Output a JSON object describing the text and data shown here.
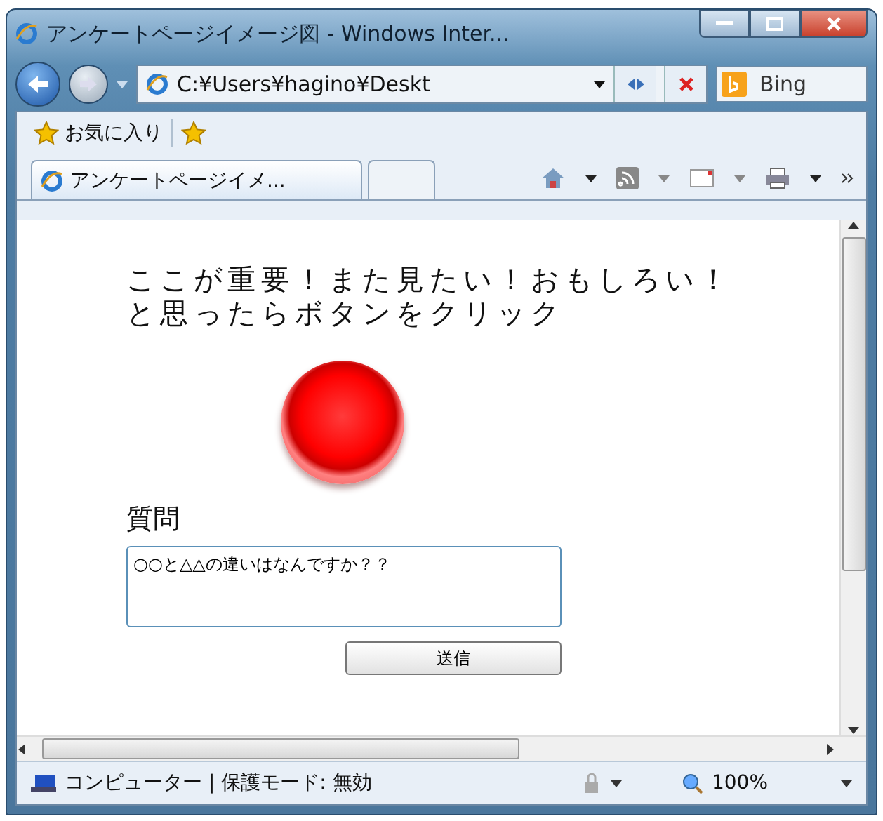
{
  "window": {
    "title": "アンケートページイメージ図 - Windows Inter..."
  },
  "address_bar": {
    "value": "C:¥Users¥hagino¥Deskt"
  },
  "search": {
    "placeholder": "Bing"
  },
  "favorites_bar": {
    "label": "お気に入り"
  },
  "tabs": [
    {
      "label": "アンケートページイメ...",
      "selected": true
    }
  ],
  "page": {
    "prompt_lines": [
      "ここが重要！また見たい！おもしろい！",
      "と思ったらボタンをクリック"
    ],
    "question_label": "質問",
    "question_field": {
      "value": "○○と△△の違いはなんですか？？"
    },
    "submit_button": "送信"
  },
  "status_bar": {
    "zone": "コンピューター | 保護モード: 無効",
    "zoom": "100%"
  }
}
